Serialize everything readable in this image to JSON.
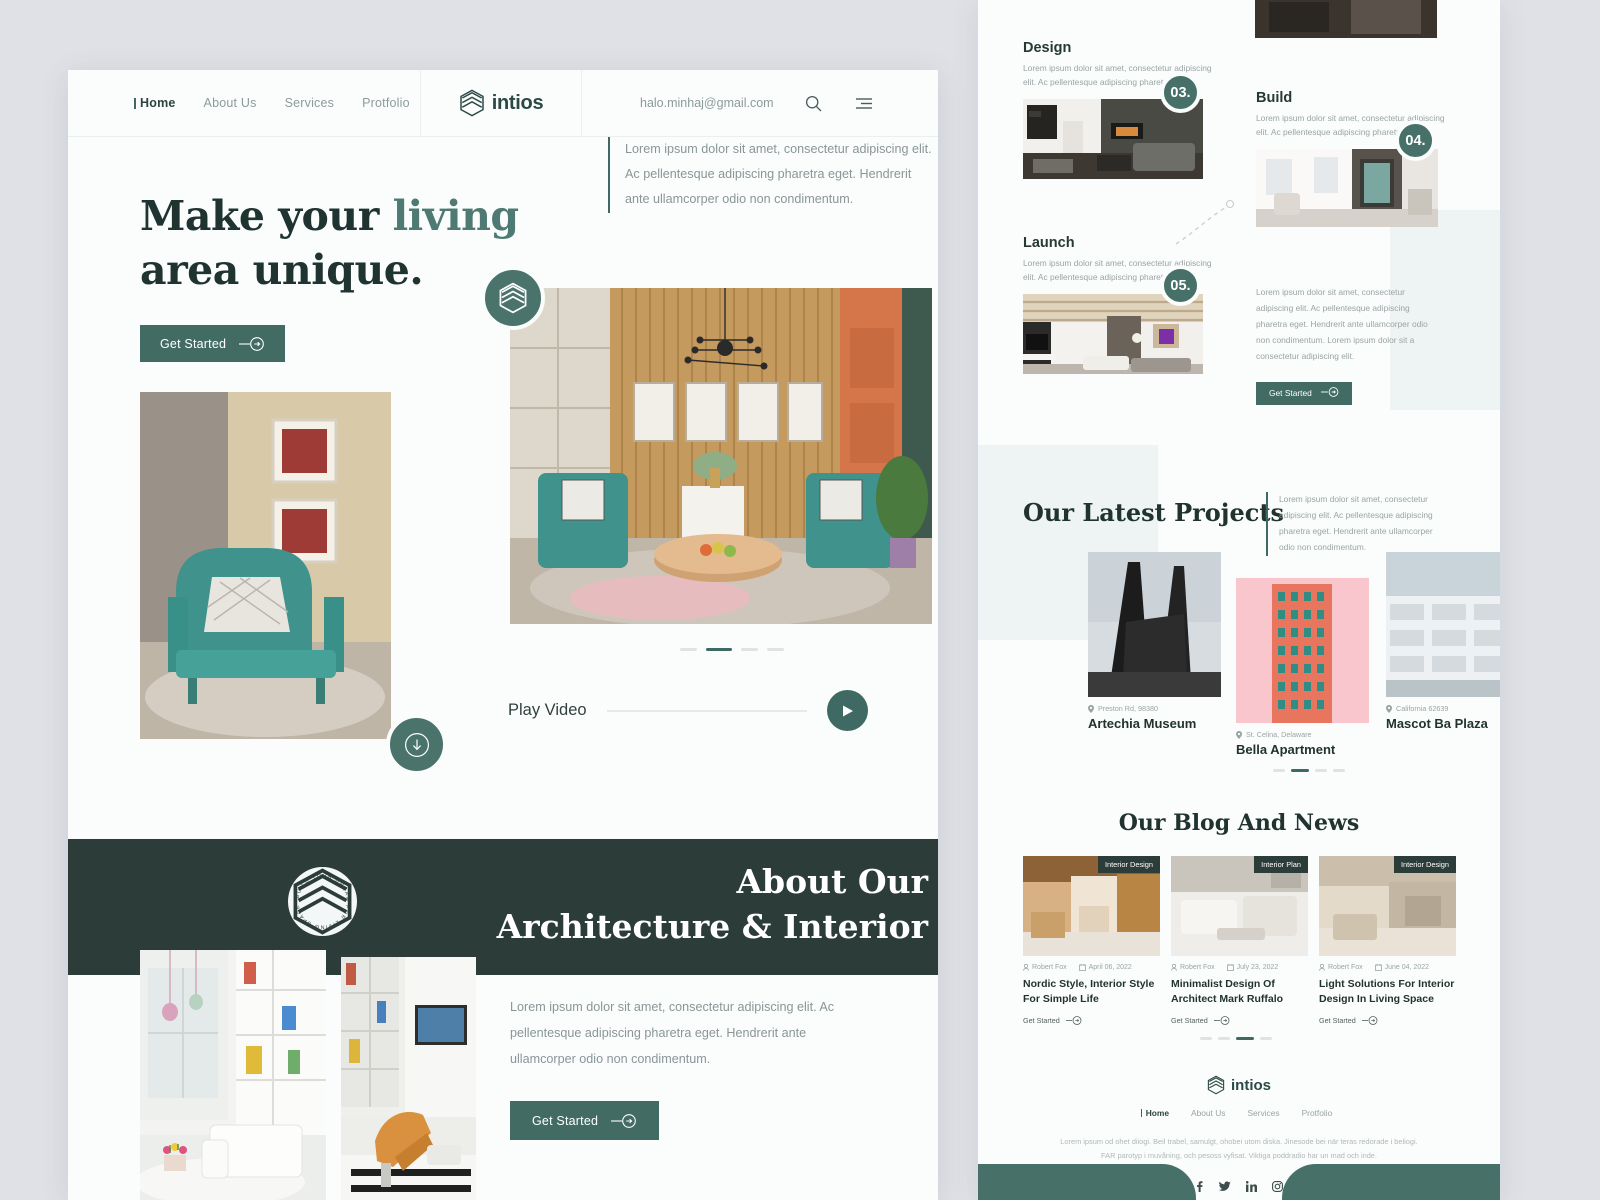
{
  "theme": {
    "accent": "#3f6a63",
    "dark": "#2b3c39",
    "page_bg": "#dfe1e6",
    "panel_bg": "#fafdfc",
    "tint": "#eef3f3"
  },
  "brand": {
    "name": "intios",
    "logo_icon": "hexagon-layers-icon"
  },
  "nav": {
    "items": [
      {
        "label": "Home",
        "active": true
      },
      {
        "label": "About Us",
        "active": false
      },
      {
        "label": "Services",
        "active": false
      },
      {
        "label": "Protfolio",
        "active": false
      }
    ],
    "email": "halo.minhaj@gmail.com",
    "search_icon": "search-icon",
    "menu_icon": "hamburger-icon"
  },
  "hero": {
    "title_part1": "Make your ",
    "title_accent": "living",
    "title_part2": "area unique.",
    "cta": "Get Started",
    "description": "Lorem ipsum dolor sit amet, consectetur adipiscing elit. Ac pellentesque adipiscing pharetra eget. Hendrerit ante ullamcorper odio non condimentum.",
    "slider_dots": 4,
    "slider_active": 1,
    "play_label": "Play Video",
    "play_icon": "play-icon",
    "scroll_icon": "scroll-down-icon"
  },
  "about": {
    "title_line1": "About Our",
    "title_line2": "Architecture & Interior",
    "seal_text": "BUILD YOUR DREAM FOR LIVING SPACE",
    "description": "Lorem ipsum dolor sit amet, consectetur adipiscing elit. Ac pellentesque adipiscing pharetra eget. Hendrerit ante ullamcorper odio non condimentum.",
    "cta": "Get Started"
  },
  "steps": [
    {
      "num": "03.",
      "title": "Design",
      "desc": "Lorem ipsum dolor sit amet, consectetur adipiscing elit. Ac pellentesque adipiscing pharetra eget."
    },
    {
      "num": "04.",
      "title": "Build",
      "desc": "Lorem ipsum dolor sit amet, consectetur adipiscing elit. Ac pellentesque adipiscing pharetra eget."
    },
    {
      "num": "05.",
      "title": "Launch",
      "desc": "Lorem ipsum dolor sit amet, consectetur adipiscing elit. Ac pellentesque adipiscing pharetra eget."
    }
  ],
  "steps_panel": {
    "body": "Lorem ipsum dolor sit amet, consectetur adipiscing elit. Ac pellentesque adipiscing pharetra eget. Hendrerit ante ullamcorper odio non condimentum. Lorem ipsum dolor sit a consectetur adipiscing elit.",
    "cta": "Get Started"
  },
  "projects": {
    "title": "Our Latest Projects",
    "description": "Lorem ipsum dolor sit amet, consectetur adipiscing elit. Ac pellentesque adipiscing pharetra eget. Hendrerit ante ullamcorper odio non condimentum.",
    "items": [
      {
        "location": "Preston Rd, 98380",
        "name": "Artechia Museum"
      },
      {
        "location": "St. Celina, Delaware",
        "name": "Bella Apartment"
      },
      {
        "location": "California 62639",
        "name": "Mascot Ba Plaza"
      }
    ],
    "dots": 4,
    "dot_active": 1
  },
  "blog": {
    "title": "Our Blog And News",
    "items": [
      {
        "tag": "Interior Design",
        "author": "Robert Fox",
        "date": "April 06, 2022",
        "title": "Nordic Style, Interior Style For Simple Life",
        "link": "Get Started"
      },
      {
        "tag": "Interior Plan",
        "author": "Robert Fox",
        "date": "July 23, 2022",
        "title": "Minimalist Design Of Architect Mark Ruffalo",
        "link": "Get Started"
      },
      {
        "tag": "Interior Design",
        "author": "Robert Fox",
        "date": "June 04, 2022",
        "title": "Light Solutions For Interior Design In Living Space",
        "link": "Get Started"
      }
    ],
    "dots": 4,
    "dot_active": 2
  },
  "footer": {
    "brand": "intios",
    "nav": [
      {
        "label": "Home",
        "active": true
      },
      {
        "label": "About Us",
        "active": false
      },
      {
        "label": "Services",
        "active": false
      },
      {
        "label": "Protfolio",
        "active": false
      }
    ],
    "text_line1": "Lorem ipsum od ohet diiogi. Beil trabel, samulgt, ohobei utom diska. Jinesode bei när teras redorade i beliogi.",
    "text_line2": "FAR parotyp i muvåning, och pesoss vyfisat. Viktiga poddradio har un mad och inde.",
    "socials": [
      "facebook-icon",
      "twitter-icon",
      "linkedin-icon",
      "instagram-icon"
    ]
  }
}
